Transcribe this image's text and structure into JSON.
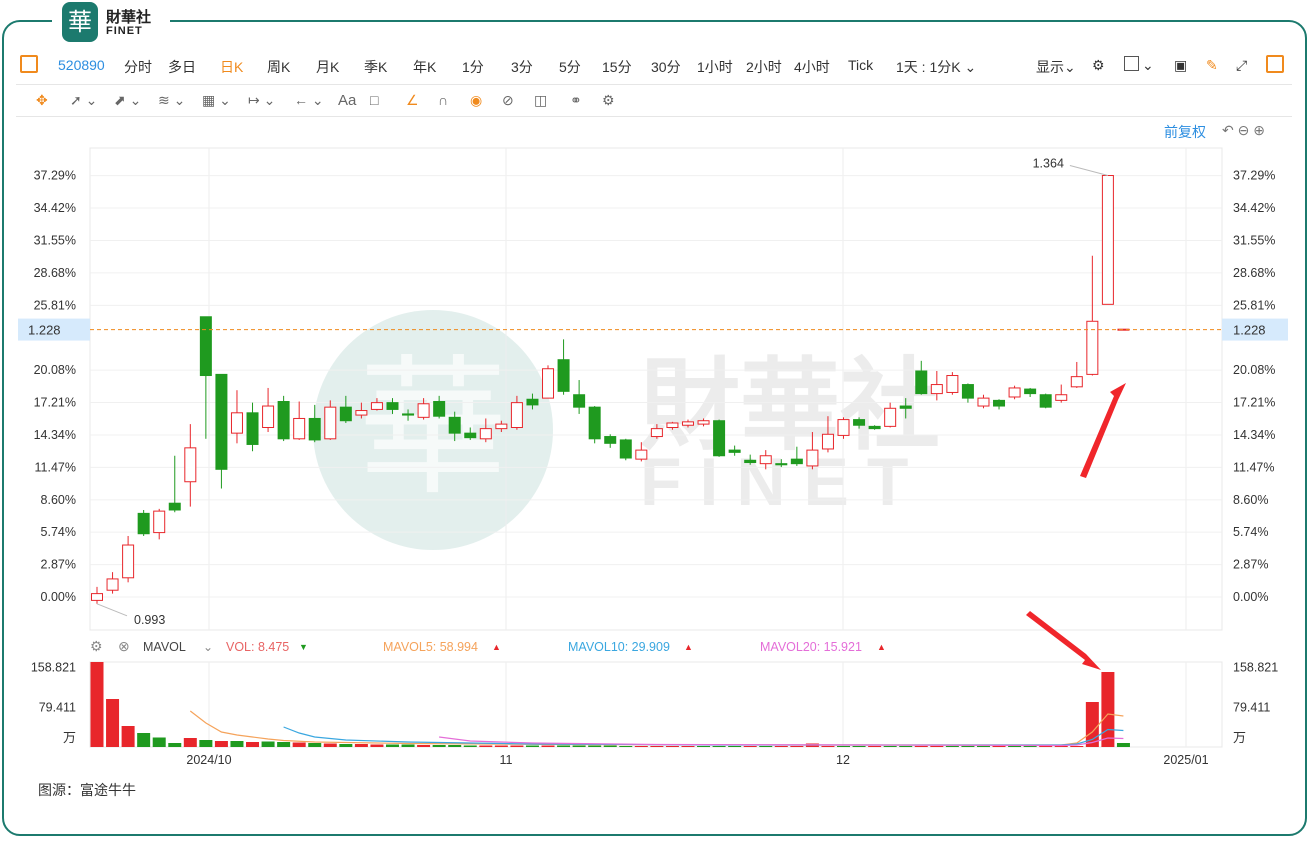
{
  "logo": {
    "seal": "華",
    "cn": "財華社",
    "en": "FINET"
  },
  "toolbar": {
    "layout_icon": "layout-panel-icon",
    "code": "520890",
    "periods": [
      "分时",
      "多日",
      "日K",
      "周K",
      "月K",
      "季K",
      "年K",
      "1分",
      "3分",
      "5分",
      "15分",
      "30分",
      "1小时",
      "2小时",
      "4小时",
      "Tick"
    ],
    "active_period": "日K",
    "interval_select": "1天 : 1分K",
    "display_label": "显示",
    "right_icons": [
      "settings-icon",
      "square-icon",
      "camera-icon",
      "pencil-icon",
      "expand-icon",
      "sidebar-icon"
    ]
  },
  "drawing_tools": [
    "move-icon",
    "line-icon",
    "ray-icon",
    "polyline-icon",
    "measure-icon",
    "range-icon",
    "arrow-left-icon",
    "text-icon",
    "comment-icon",
    "brush-icon",
    "magnet-icon",
    "eye-icon",
    "hide-icon",
    "trash-icon",
    "link-icon",
    "gear-icon"
  ],
  "drawing_text_label": "Aa",
  "adjust_label": "前复权",
  "watermark": {
    "cn": "財華社",
    "en": "FINET"
  },
  "colors": {
    "up": "#e8262b",
    "down": "#1f9a1f",
    "accent": "#f08a1d",
    "link": "#2d8ee0",
    "frame": "#1c7a6e",
    "mavol5": "#f5a35b",
    "mavol10": "#3aa7e0",
    "mavol20": "#e46ed8"
  },
  "volume_header": {
    "indicator": "MAVOL",
    "vol": "VOL: 8.475",
    "mavol5": "MAVOL5: 58.994",
    "mavol10": "MAVOL10: 29.909",
    "mavol20": "MAVOL20: 15.921"
  },
  "source": "图源：富途牛牛",
  "chart_data": {
    "type": "candlestick",
    "base_price": 0.993,
    "y_tick_labels": [
      "37.29%",
      "34.42%",
      "31.55%",
      "28.68%",
      "25.81%",
      "20.08%",
      "17.21%",
      "14.34%",
      "11.47%",
      "8.60%",
      "5.74%",
      "2.87%",
      "0.00%"
    ],
    "ylim_pct": [
      -2,
      41
    ],
    "current_price_label": "1.228",
    "high_label": "1.364",
    "low_label": "0.993",
    "x_tick_labels": [
      "2024/10",
      "11",
      "12",
      "2025/01"
    ],
    "volume_tick_labels": [
      "158.821",
      "79.411",
      "万"
    ],
    "volume_ylim": [
      0,
      170
    ],
    "candles": [
      {
        "o": -0.3,
        "c": 0.3,
        "h": 0.9,
        "l": -0.6
      },
      {
        "o": 0.6,
        "c": 1.6,
        "h": 2.2,
        "l": 0.3
      },
      {
        "o": 1.7,
        "c": 4.6,
        "h": 5.4,
        "l": 1.3
      },
      {
        "o": 7.4,
        "c": 5.6,
        "h": 7.7,
        "l": 5.4
      },
      {
        "o": 5.7,
        "c": 7.6,
        "h": 7.8,
        "l": 5.1
      },
      {
        "o": 8.3,
        "c": 7.7,
        "h": 12.5,
        "l": 7.5
      },
      {
        "o": 10.2,
        "c": 13.2,
        "h": 15.3,
        "l": 8.0
      },
      {
        "o": 24.8,
        "c": 19.6,
        "h": 24.8,
        "l": 14.0
      },
      {
        "o": 19.7,
        "c": 11.3,
        "h": 19.7,
        "l": 9.6
      },
      {
        "o": 14.5,
        "c": 16.3,
        "h": 18.3,
        "l": 13.6
      },
      {
        "o": 16.3,
        "c": 13.5,
        "h": 17.2,
        "l": 12.9
      },
      {
        "o": 15.0,
        "c": 16.9,
        "h": 18.5,
        "l": 14.6
      },
      {
        "o": 17.3,
        "c": 14.0,
        "h": 17.8,
        "l": 13.8
      },
      {
        "o": 14.0,
        "c": 15.8,
        "h": 17.3,
        "l": 13.9
      },
      {
        "o": 15.8,
        "c": 13.9,
        "h": 17.0,
        "l": 13.7
      },
      {
        "o": 14.0,
        "c": 16.8,
        "h": 17.4,
        "l": 13.9
      },
      {
        "o": 16.8,
        "c": 15.6,
        "h": 17.8,
        "l": 15.4
      },
      {
        "o": 16.1,
        "c": 16.5,
        "h": 17.2,
        "l": 15.8
      },
      {
        "o": 16.6,
        "c": 17.2,
        "h": 17.6,
        "l": 16.5
      },
      {
        "o": 17.2,
        "c": 16.6,
        "h": 17.6,
        "l": 16.2
      },
      {
        "o": 16.2,
        "c": 16.1,
        "h": 16.6,
        "l": 15.6
      },
      {
        "o": 15.9,
        "c": 17.1,
        "h": 17.6,
        "l": 15.7
      },
      {
        "o": 17.3,
        "c": 16.0,
        "h": 17.8,
        "l": 15.8
      },
      {
        "o": 15.9,
        "c": 14.5,
        "h": 16.4,
        "l": 13.8
      },
      {
        "o": 14.5,
        "c": 14.1,
        "h": 15.0,
        "l": 13.9
      },
      {
        "o": 14.0,
        "c": 14.9,
        "h": 15.8,
        "l": 13.7
      },
      {
        "o": 14.9,
        "c": 15.3,
        "h": 15.6,
        "l": 14.6
      },
      {
        "o": 15.0,
        "c": 17.2,
        "h": 17.8,
        "l": 14.8
      },
      {
        "o": 17.5,
        "c": 17.0,
        "h": 18.0,
        "l": 16.6
      },
      {
        "o": 17.6,
        "c": 20.2,
        "h": 20.5,
        "l": 17.6
      },
      {
        "o": 21.0,
        "c": 18.2,
        "h": 22.8,
        "l": 17.9
      },
      {
        "o": 17.9,
        "c": 16.8,
        "h": 19.2,
        "l": 16.2
      },
      {
        "o": 16.8,
        "c": 14.0,
        "h": 16.9,
        "l": 13.6
      },
      {
        "o": 14.2,
        "c": 13.6,
        "h": 14.4,
        "l": 13.2
      },
      {
        "o": 13.9,
        "c": 12.3,
        "h": 14.0,
        "l": 12.1
      },
      {
        "o": 12.2,
        "c": 13.0,
        "h": 13.7,
        "l": 12.0
      },
      {
        "o": 14.2,
        "c": 14.9,
        "h": 15.3,
        "l": 14.0
      },
      {
        "o": 15.0,
        "c": 15.4,
        "h": 15.5,
        "l": 14.8
      },
      {
        "o": 15.2,
        "c": 15.5,
        "h": 15.7,
        "l": 15.0
      },
      {
        "o": 15.3,
        "c": 15.6,
        "h": 15.8,
        "l": 15.1
      },
      {
        "o": 15.6,
        "c": 12.5,
        "h": 15.7,
        "l": 12.4
      },
      {
        "o": 13.0,
        "c": 12.8,
        "h": 13.4,
        "l": 12.5
      },
      {
        "o": 12.1,
        "c": 11.9,
        "h": 12.6,
        "l": 11.7
      },
      {
        "o": 11.8,
        "c": 12.5,
        "h": 13.0,
        "l": 11.3
      },
      {
        "o": 11.8,
        "c": 11.7,
        "h": 12.2,
        "l": 11.5
      },
      {
        "o": 12.2,
        "c": 11.8,
        "h": 13.3,
        "l": 11.6
      },
      {
        "o": 11.6,
        "c": 13.0,
        "h": 14.6,
        "l": 11.3
      },
      {
        "o": 13.1,
        "c": 14.4,
        "h": 16.0,
        "l": 12.8
      },
      {
        "o": 14.3,
        "c": 15.7,
        "h": 15.9,
        "l": 14.0
      },
      {
        "o": 15.7,
        "c": 15.2,
        "h": 15.9,
        "l": 14.9
      },
      {
        "o": 15.1,
        "c": 14.9,
        "h": 15.2,
        "l": 14.8
      },
      {
        "o": 15.1,
        "c": 16.7,
        "h": 17.2,
        "l": 15.0
      },
      {
        "o": 16.9,
        "c": 16.7,
        "h": 17.6,
        "l": 15.8
      },
      {
        "o": 20.0,
        "c": 18.0,
        "h": 20.9,
        "l": 17.9
      },
      {
        "o": 18.0,
        "c": 18.8,
        "h": 20.0,
        "l": 17.4
      },
      {
        "o": 18.1,
        "c": 19.6,
        "h": 19.9,
        "l": 17.9
      },
      {
        "o": 18.8,
        "c": 17.6,
        "h": 18.9,
        "l": 17.2
      },
      {
        "o": 16.9,
        "c": 17.6,
        "h": 17.9,
        "l": 16.7
      },
      {
        "o": 17.4,
        "c": 16.9,
        "h": 17.5,
        "l": 16.6
      },
      {
        "o": 17.7,
        "c": 18.5,
        "h": 18.7,
        "l": 17.5
      },
      {
        "o": 18.4,
        "c": 18.0,
        "h": 18.5,
        "l": 17.7
      },
      {
        "o": 17.9,
        "c": 16.8,
        "h": 18.0,
        "l": 16.7
      },
      {
        "o": 17.4,
        "c": 17.9,
        "h": 18.8,
        "l": 17.2
      },
      {
        "o": 18.6,
        "c": 19.5,
        "h": 20.8,
        "l": 18.5
      },
      {
        "o": 19.7,
        "c": 24.4,
        "h": 30.2,
        "l": 19.6
      },
      {
        "o": 25.9,
        "c": 37.3,
        "h": 37.3,
        "l": 25.9
      },
      {
        "o": 23.7,
        "c": 23.7,
        "h": 23.7,
        "l": 23.7
      }
    ],
    "volumes": [
      170,
      96,
      42,
      28,
      19,
      8,
      18,
      14,
      12,
      12,
      10,
      11,
      10,
      9,
      8,
      7,
      6,
      6,
      5,
      5,
      5,
      4,
      4,
      4,
      3,
      3,
      3,
      3,
      3,
      3,
      3,
      3,
      3,
      3,
      2,
      2,
      2,
      2,
      2,
      2,
      2,
      2,
      2,
      2,
      2,
      2,
      7,
      2,
      2,
      2,
      2,
      2,
      2,
      2,
      2,
      2,
      2,
      2,
      2,
      2,
      2,
      2,
      2,
      2,
      90,
      150,
      8
    ],
    "volume_colors": [
      "up",
      "up",
      "up",
      "down",
      "down",
      "down",
      "up",
      "down",
      "up",
      "down",
      "up",
      "down",
      "down",
      "up",
      "down",
      "up",
      "down",
      "up",
      "up",
      "down",
      "down",
      "up",
      "down",
      "down",
      "down",
      "up",
      "up",
      "up",
      "down",
      "up",
      "down",
      "down",
      "down",
      "down",
      "down",
      "up",
      "up",
      "up",
      "up",
      "down",
      "down",
      "down",
      "up",
      "down",
      "up",
      "up",
      "up",
      "up",
      "down",
      "down",
      "up",
      "down",
      "down",
      "up",
      "up",
      "down",
      "down",
      "down",
      "up",
      "down",
      "down",
      "up",
      "up",
      "up",
      "up",
      "up",
      "down"
    ],
    "mavol5": [
      [
        6,
        72
      ],
      [
        7,
        48
      ],
      [
        8,
        30
      ],
      [
        9,
        24
      ],
      [
        10,
        20
      ],
      [
        11,
        16
      ],
      [
        12,
        13
      ],
      [
        14,
        10
      ],
      [
        20,
        7
      ],
      [
        30,
        5
      ],
      [
        45,
        4
      ],
      [
        62,
        4
      ],
      [
        63,
        8
      ],
      [
        64,
        30
      ],
      [
        65,
        66
      ],
      [
        66,
        62
      ]
    ],
    "mavol10": [
      [
        12,
        40
      ],
      [
        13,
        28
      ],
      [
        14,
        20
      ],
      [
        16,
        14
      ],
      [
        20,
        10
      ],
      [
        28,
        6
      ],
      [
        40,
        4
      ],
      [
        62,
        4
      ],
      [
        63,
        6
      ],
      [
        64,
        15
      ],
      [
        65,
        35
      ],
      [
        66,
        33
      ]
    ],
    "mavol20": [
      [
        22,
        20
      ],
      [
        24,
        12
      ],
      [
        28,
        8
      ],
      [
        36,
        5
      ],
      [
        50,
        4
      ],
      [
        62,
        3
      ],
      [
        63,
        4
      ],
      [
        64,
        9
      ],
      [
        65,
        18
      ],
      [
        66,
        17
      ]
    ]
  }
}
